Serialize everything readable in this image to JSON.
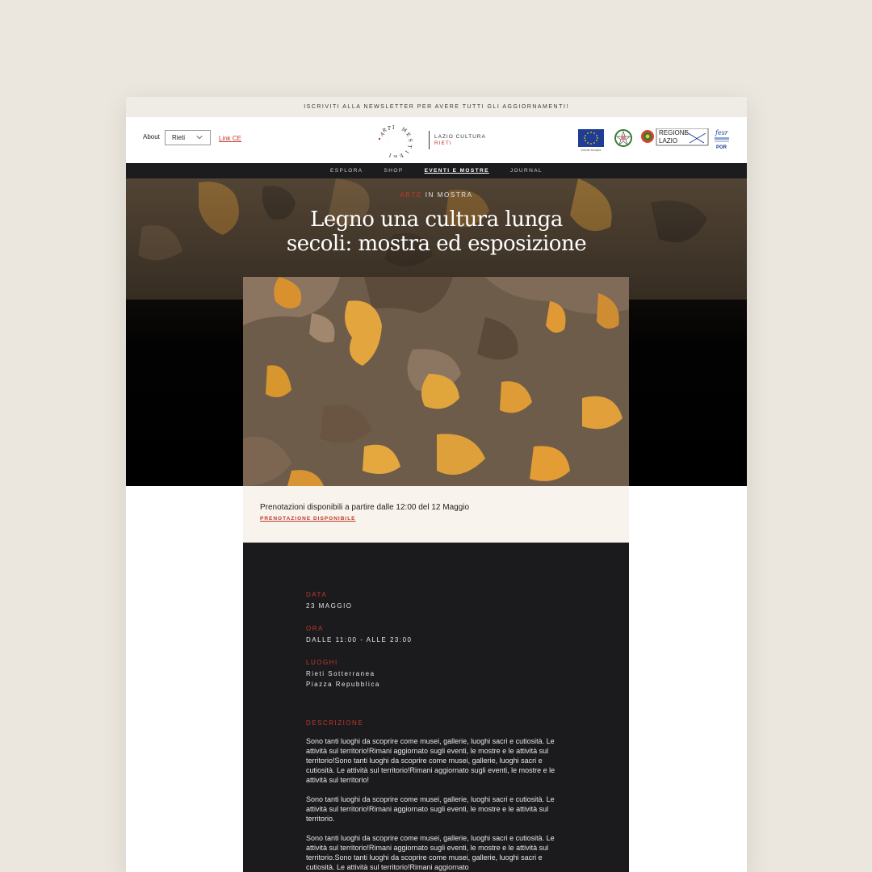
{
  "topbar": {
    "newsletter": "ISCRIVITI ALLA NEWSLETTER PER AVERE TUTTI GLI AGGIORNAMENTI!"
  },
  "header": {
    "about": "About",
    "city_select": "Rieti",
    "link_ce": "Link CE",
    "logo_letters": "ARTI MESTIERI",
    "logo_title": "LAZIO CULTURA",
    "logo_subtitle": "RIETI",
    "eu_caption": "Unione europea",
    "regione": "REGIONE LAZIO",
    "por_label": "POR"
  },
  "nav": {
    "items": [
      {
        "label": "ESPLORA"
      },
      {
        "label": "SHOP"
      },
      {
        "label": "EVENTI E MOSTRE"
      },
      {
        "label": "JOURNAL"
      }
    ]
  },
  "hero": {
    "kicker_red": "ARTE",
    "kicker_rest": " IN MOSTRA",
    "title_line1": "Legno una cultura lunga",
    "title_line2": "secoli: mostra ed esposizione"
  },
  "booking": {
    "text": "Prenotazioni disponibili a partire dalle 12:00 del 12 Maggio",
    "link": "PRENOTAZIONE DISPONIBILE"
  },
  "details": {
    "data_label": "DATA",
    "data_value": "23 MAGGIO",
    "ora_label": "ORA",
    "ora_value": "DALLE 11:00 - ALLE 23:00",
    "luoghi_label": "LUOGHI",
    "luoghi_value_1": "Rieti Sotterranea",
    "luoghi_value_2": "Piazza Repubblica",
    "descrizione_label": "DESCRIZIONE",
    "paragraph_1": "Sono tanti luoghi da scoprire come musei, gallerie, luoghi sacri e cutiosità. Le attività sul territorio!Rimani aggiornato sugli eventi, le mostre e le attività sul territorio!Sono tanti luoghi da scoprire come musei, gallerie, luoghi sacri e cutiosità. Le attività sul territorio!Rimani aggiornato sugli eventi, le mostre e le attività sul territorio!",
    "paragraph_2": "Sono tanti luoghi da scoprire come musei, gallerie, luoghi sacri e cutiosità. Le attività sul territorio!Rimani aggiornato sugli eventi, le mostre e le attività sul territorio.",
    "paragraph_3": "Sono tanti luoghi da scoprire come musei, gallerie, luoghi sacri e cutiosità. Le attività sul territorio!Rimani aggiornato sugli eventi, le mostre e le attività sul territorio.Sono tanti luoghi da scoprire come musei, gallerie, luoghi sacri e cutiosità. Le attività sul territorio!Rimani aggiornato"
  },
  "colors": {
    "accent": "#c0392b",
    "dark": "#1b1b1e",
    "background": "#ebe7de",
    "cream": "#f8f3ec"
  }
}
